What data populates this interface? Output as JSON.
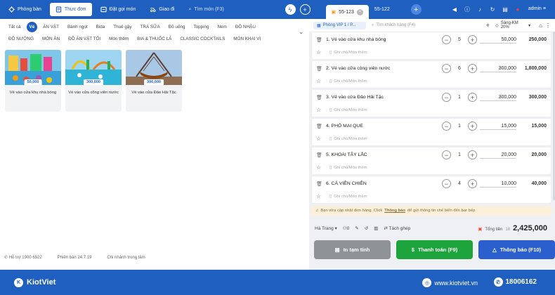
{
  "header": {
    "nav": [
      {
        "label": "Phòng bàn",
        "icon": "table-icon"
      },
      {
        "label": "Thực đơn",
        "icon": "menu-book-icon"
      },
      {
        "label": "Đặt gọi món",
        "icon": "order-icon"
      },
      {
        "label": "Giao đi",
        "icon": "delivery-icon"
      }
    ],
    "search_placeholder": "Tìm món (F3)",
    "order_tabs": [
      {
        "label": "55-123"
      },
      {
        "label": "55-122"
      }
    ],
    "user": "admin"
  },
  "categories": [
    "Tất cả",
    "Vé",
    "ĂN VẶT",
    "Bánh ngọt",
    "Bida",
    "Thuê gậy",
    "TRÀ SỮA",
    "Đồ uống",
    "Topping",
    "Nem",
    "ĐỒ NHẬU",
    "ĐỒ NƯỚNG",
    "MÓN ĂN",
    "ĐỒ ĂN VẶT TỐI",
    "Món thêm",
    "BIA & THUỐC LÁ",
    "CLASSIC COCKTAILS",
    "MÓN KHAI VỊ"
  ],
  "active_category_index": 1,
  "products": [
    {
      "name": "Vé vào cửa khu nhà bóng",
      "price": "50,000"
    },
    {
      "name": "Vé vào cửa công viên nước",
      "price": "300,000"
    },
    {
      "name": "Vé vào cửa Đảo Hải Tặc",
      "price": "300,000"
    }
  ],
  "footer_left": {
    "support": "Hỗ trợ 1900 6522",
    "version": "Phiên bản 24.7.19",
    "branch": "Chi nhánh trung tâm"
  },
  "order": {
    "table": "Phòng VIP 1 / P...",
    "customer_placeholder": "Tìm khách hàng (F4)",
    "price_list": "Sáng-KM 20%",
    "note_placeholder": "Ghi chú/Món thêm",
    "lines": [
      {
        "name": "1. Vé vào cửa khu nhà bóng",
        "qty": "5",
        "price": "50,000",
        "total": "250,000"
      },
      {
        "name": "2. Vé vào cửa công viên nước",
        "qty": "6",
        "price": "300,000",
        "total": "1,800,000"
      },
      {
        "name": "3. Vé vào cửa Đảo Hải Tặc",
        "qty": "1",
        "price": "300,000",
        "total": "300,000"
      },
      {
        "name": "4. PHÔ MAI QUE",
        "qty": "1",
        "price": "15,000",
        "total": "15,000"
      },
      {
        "name": "5. KHOAI TÂY LẮC",
        "qty": "1",
        "price": "20,000",
        "total": "20,000"
      },
      {
        "name": "6. CÁ VIÊN CHIÊN",
        "qty": "4",
        "price": "10,000",
        "total": "40,000"
      }
    ],
    "notice_before": "Bạn vừa cập nhật đơn hàng. Click",
    "notice_link": "Thông báo",
    "notice_after": "để gửi thông tin chế biến đến bar bếp",
    "staff": "Hà Trang",
    "guest_count": "0",
    "split_label": "Tách ghép",
    "total_label": "Tổng tiền",
    "total_count": "18",
    "total_value": "2,425,000",
    "btn_print": "In tạm tính",
    "btn_pay": "Thanh toán (F9)",
    "btn_notify": "Thông báo (F10)"
  },
  "bottom": {
    "brand": "KiotViet",
    "website": "www.kiotviet.vn",
    "hotline": "18006162"
  }
}
